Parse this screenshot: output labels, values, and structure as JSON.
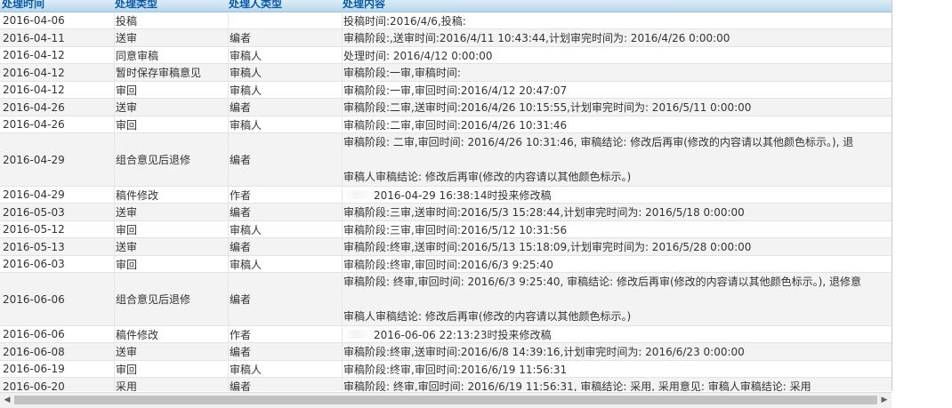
{
  "header": {
    "col_time": "处理时间",
    "col_type": "处理类型",
    "col_handler": "处理人类型",
    "col_content": "处理内容"
  },
  "rows": [
    {
      "time": "2016-04-06",
      "type": "投稿",
      "handler": "",
      "content": "投稿时间:2016/4/6,投稿:"
    },
    {
      "time": "2016-04-11",
      "type": "送审",
      "handler": "编者",
      "content": "审稿阶段:,送审时间:2016/4/11 10:43:44,计划审完时间为: 2016/4/26 0:00:00"
    },
    {
      "time": "2016-04-12",
      "type": "同意审稿",
      "handler": "审稿人",
      "content": "处理时间: 2016/4/12 0:00:00"
    },
    {
      "time": "2016-04-12",
      "type": "暂时保存审稿意见",
      "handler": "审稿人",
      "content": "审稿阶段:一审,审稿时间:"
    },
    {
      "time": "2016-04-12",
      "type": "审回",
      "handler": "审稿人",
      "content": "审稿阶段:一审,审回时间:2016/4/12 20:47:07"
    },
    {
      "time": "2016-04-26",
      "type": "送审",
      "handler": "编者",
      "content": "审稿阶段:二审,送审时间:2016/4/26 10:15:55,计划审完时间为: 2016/5/11 0:00:00"
    },
    {
      "time": "2016-04-26",
      "type": "审回",
      "handler": "审稿人",
      "content": "审稿阶段:二审,审回时间:2016/4/26 10:31:46"
    },
    {
      "time": "2016-04-29",
      "type": "组合意见后退修",
      "handler": "编者",
      "content": "审稿阶段: 二审,审回时间: 2016/4/26 10:31:46, 审稿结论: 修改后再审(修改的内容请以其他颜色标示。), 退",
      "content2": "审稿人审稿结论: 修改后再审(修改的内容请以其他颜色标示。)"
    },
    {
      "time": "2016-04-29",
      "type": "稿件修改",
      "handler": "作者",
      "content": "2016-04-29 16:38:14时投来修改稿"
    },
    {
      "time": "2016-05-03",
      "type": "送审",
      "handler": "编者",
      "content": "审稿阶段:三审,送审时间:2016/5/3 15:28:44,计划审完时间为: 2016/5/18 0:00:00"
    },
    {
      "time": "2016-05-12",
      "type": "审回",
      "handler": "审稿人",
      "content": "审稿阶段:三审,审回时间:2016/5/12 10:31:56"
    },
    {
      "time": "2016-05-13",
      "type": "送审",
      "handler": "编者",
      "content": "审稿阶段:终审,送审时间:2016/5/13 15:18:09,计划审完时间为: 2016/5/28 0:00:00"
    },
    {
      "time": "2016-06-03",
      "type": "审回",
      "handler": "审稿人",
      "content": "审稿阶段:终审,审回时间:2016/6/3 9:25:40"
    },
    {
      "time": "2016-06-06",
      "type": "组合意见后退修",
      "handler": "编者",
      "content": "审稿阶段: 终审,审回时间: 2016/6/3 9:25:40, 审稿结论: 修改后再审(修改的内容请以其他颜色标示。), 退修意",
      "content2": "审稿人审稿结论: 修改后再审(修改的内容请以其他颜色标示。)"
    },
    {
      "time": "2016-06-06",
      "type": "稿件修改",
      "handler": "作者",
      "content": "2016-06-06 22:13:23时投来修改稿"
    },
    {
      "time": "2016-06-08",
      "type": "送审",
      "handler": "编者",
      "content": "审稿阶段:终审,送审时间:2016/6/8 14:39:16,计划审完时间为: 2016/6/23 0:00:00"
    },
    {
      "time": "2016-06-19",
      "type": "审回",
      "handler": "审稿人",
      "content": "审稿阶段:终审,审回时间:2016/6/19 11:56:31"
    },
    {
      "time": "2016-06-20",
      "type": "采用",
      "handler": "编者",
      "content": "审稿阶段: 终审,审回时间: 2016/6/19 11:56:31, 审稿结论: 采用, 采用意见: 审稿人审稿结论: 采用"
    }
  ],
  "icons": {
    "scroll_left": "arrow-left-icon",
    "scroll_right": "arrow-right-icon"
  }
}
